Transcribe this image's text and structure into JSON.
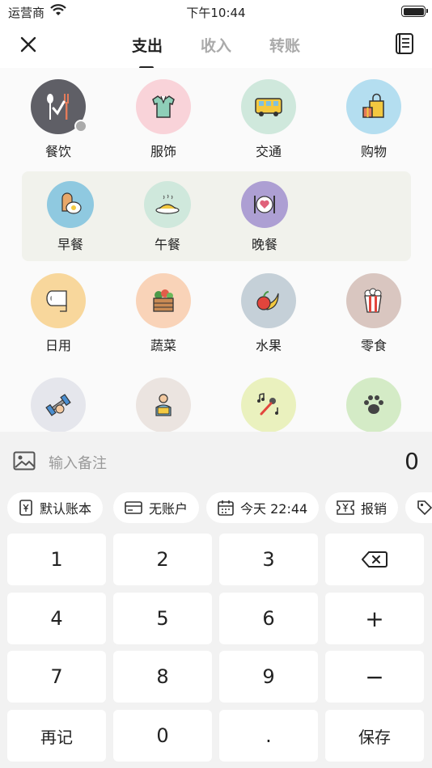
{
  "status_bar": {
    "carrier": "运营商",
    "time": "下午10:44"
  },
  "nav": {
    "tabs": [
      "支出",
      "收入",
      "转账"
    ],
    "active_tab": "支出"
  },
  "categories": {
    "row1": [
      {
        "label": "餐饮",
        "color": "#5f5f66",
        "icon": "utensils-icon",
        "selected": true
      },
      {
        "label": "服饰",
        "color": "#f9d3d9",
        "icon": "shirt-icon"
      },
      {
        "label": "交通",
        "color": "#cfe8dc",
        "icon": "bus-icon"
      },
      {
        "label": "购物",
        "color": "#b4def0",
        "icon": "shopping-bag-icon"
      }
    ],
    "sub": [
      {
        "label": "早餐",
        "color": "#8fc9e0",
        "icon": "toast-egg-icon"
      },
      {
        "label": "午餐",
        "color": "#cfe8dc",
        "icon": "lunch-plate-icon"
      },
      {
        "label": "晚餐",
        "color": "#ad9fd3",
        "icon": "dinner-plate-icon"
      }
    ],
    "row2": [
      {
        "label": "日用",
        "color": "#f8d79c",
        "icon": "toilet-paper-icon"
      },
      {
        "label": "蔬菜",
        "color": "#f9d3b8",
        "icon": "vegetables-icon"
      },
      {
        "label": "水果",
        "color": "#c5d0d8",
        "icon": "fruit-icon"
      },
      {
        "label": "零食",
        "color": "#d9c6c0",
        "icon": "popcorn-icon"
      }
    ],
    "row3": [
      {
        "label": "",
        "color": "#e5e6ec",
        "icon": "dumbbell-icon"
      },
      {
        "label": "",
        "color": "#ebe4e0",
        "icon": "reading-person-icon"
      },
      {
        "label": "",
        "color": "#eaf1be",
        "icon": "microphone-music-icon"
      },
      {
        "label": "",
        "color": "#d4ebc6",
        "icon": "paw-icon"
      }
    ]
  },
  "note": {
    "placeholder": "输入备注",
    "amount": "0"
  },
  "chips": [
    "默认账本",
    "无账户",
    "今天 22:44",
    "报销"
  ],
  "keypad": [
    [
      "1",
      "2",
      "3",
      "⌫"
    ],
    [
      "4",
      "5",
      "6",
      "+"
    ],
    [
      "7",
      "8",
      "9",
      "−"
    ],
    [
      "再记",
      "0",
      ".",
      "保存"
    ]
  ]
}
